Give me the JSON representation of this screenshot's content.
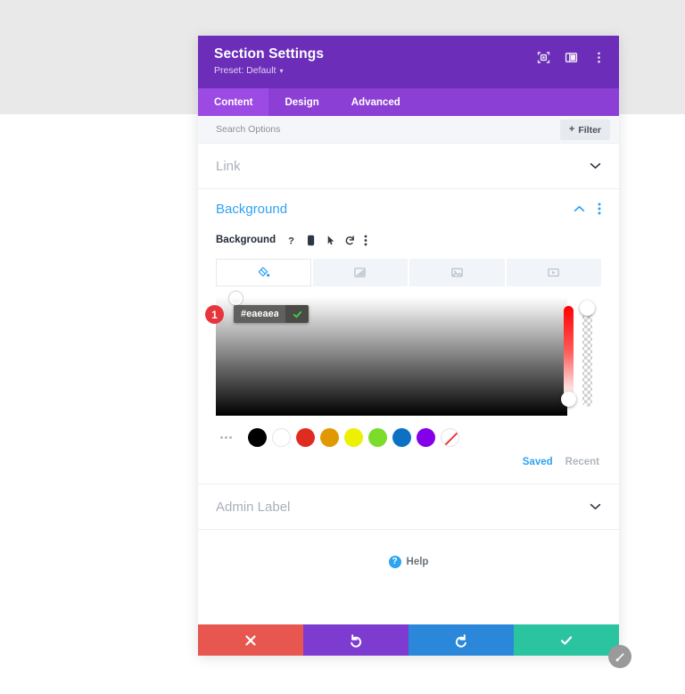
{
  "window": {
    "title": "Section Settings",
    "preset_label": "Preset: Default",
    "preset_caret": "▾",
    "icons": [
      "target-icon",
      "layout-icon",
      "kebab-menu-icon"
    ]
  },
  "tabs": [
    {
      "label": "Content",
      "active": true
    },
    {
      "label": "Design",
      "active": false
    },
    {
      "label": "Advanced",
      "active": false
    }
  ],
  "search": {
    "placeholder": "Search Options",
    "value": "",
    "filter_label": "Filter",
    "filter_plus": "+"
  },
  "sections": {
    "link": {
      "label": "Link",
      "expanded": false
    },
    "background": {
      "label": "Background",
      "expanded": true,
      "accent_color": "#2ea3f2",
      "sub_label": "Background",
      "sub_icons": [
        "help-icon",
        "mobile-icon",
        "hover-cursor-icon",
        "reset-icon",
        "kebab-menu-icon"
      ],
      "type_tabs": [
        {
          "name": "color-fill",
          "active": true
        },
        {
          "name": "gradient",
          "active": false
        },
        {
          "name": "image",
          "active": false
        },
        {
          "name": "video",
          "active": false
        }
      ],
      "color_picker": {
        "hex_value": "#eaeaea",
        "confirm_label": "✓",
        "annotation_badge": "1",
        "hue_handle_position": "bottom",
        "alpha_handle_position": "top",
        "sv_handle_position": "top-left"
      },
      "swatches": [
        {
          "name": "black",
          "color": "#000000"
        },
        {
          "name": "white",
          "color": "#ffffff"
        },
        {
          "name": "red",
          "color": "#e02b20"
        },
        {
          "name": "orange",
          "color": "#e09900"
        },
        {
          "name": "yellow",
          "color": "#edf000"
        },
        {
          "name": "green",
          "color": "#7cdb2b"
        },
        {
          "name": "blue",
          "color": "#0c71c3"
        },
        {
          "name": "purple",
          "color": "#8300e9"
        },
        {
          "name": "transparent",
          "color": "transparent"
        }
      ],
      "swatch_tabs": [
        {
          "label": "Saved",
          "active": true
        },
        {
          "label": "Recent",
          "active": false
        }
      ]
    },
    "admin_label": {
      "label": "Admin Label",
      "expanded": false
    }
  },
  "help": {
    "label": "Help",
    "glyph": "?"
  },
  "footer_buttons": [
    {
      "name": "cancel-button",
      "icon": "close-icon",
      "color": "#e7574f"
    },
    {
      "name": "undo-button",
      "icon": "undo-icon",
      "color": "#7e3bd0"
    },
    {
      "name": "redo-button",
      "icon": "redo-icon",
      "color": "#2b87da"
    },
    {
      "name": "save-button",
      "icon": "check-icon",
      "color": "#2ac4a1"
    }
  ],
  "colors": {
    "titlebar": "#6c2eb9",
    "tabbar": "#8c3fd4",
    "tab_active": "#9c4ae4",
    "page_top": "#e9e9e9",
    "page_bottom": "#ffffff",
    "accent_blue": "#2ea3f2",
    "badge_red": "#e8353b"
  }
}
